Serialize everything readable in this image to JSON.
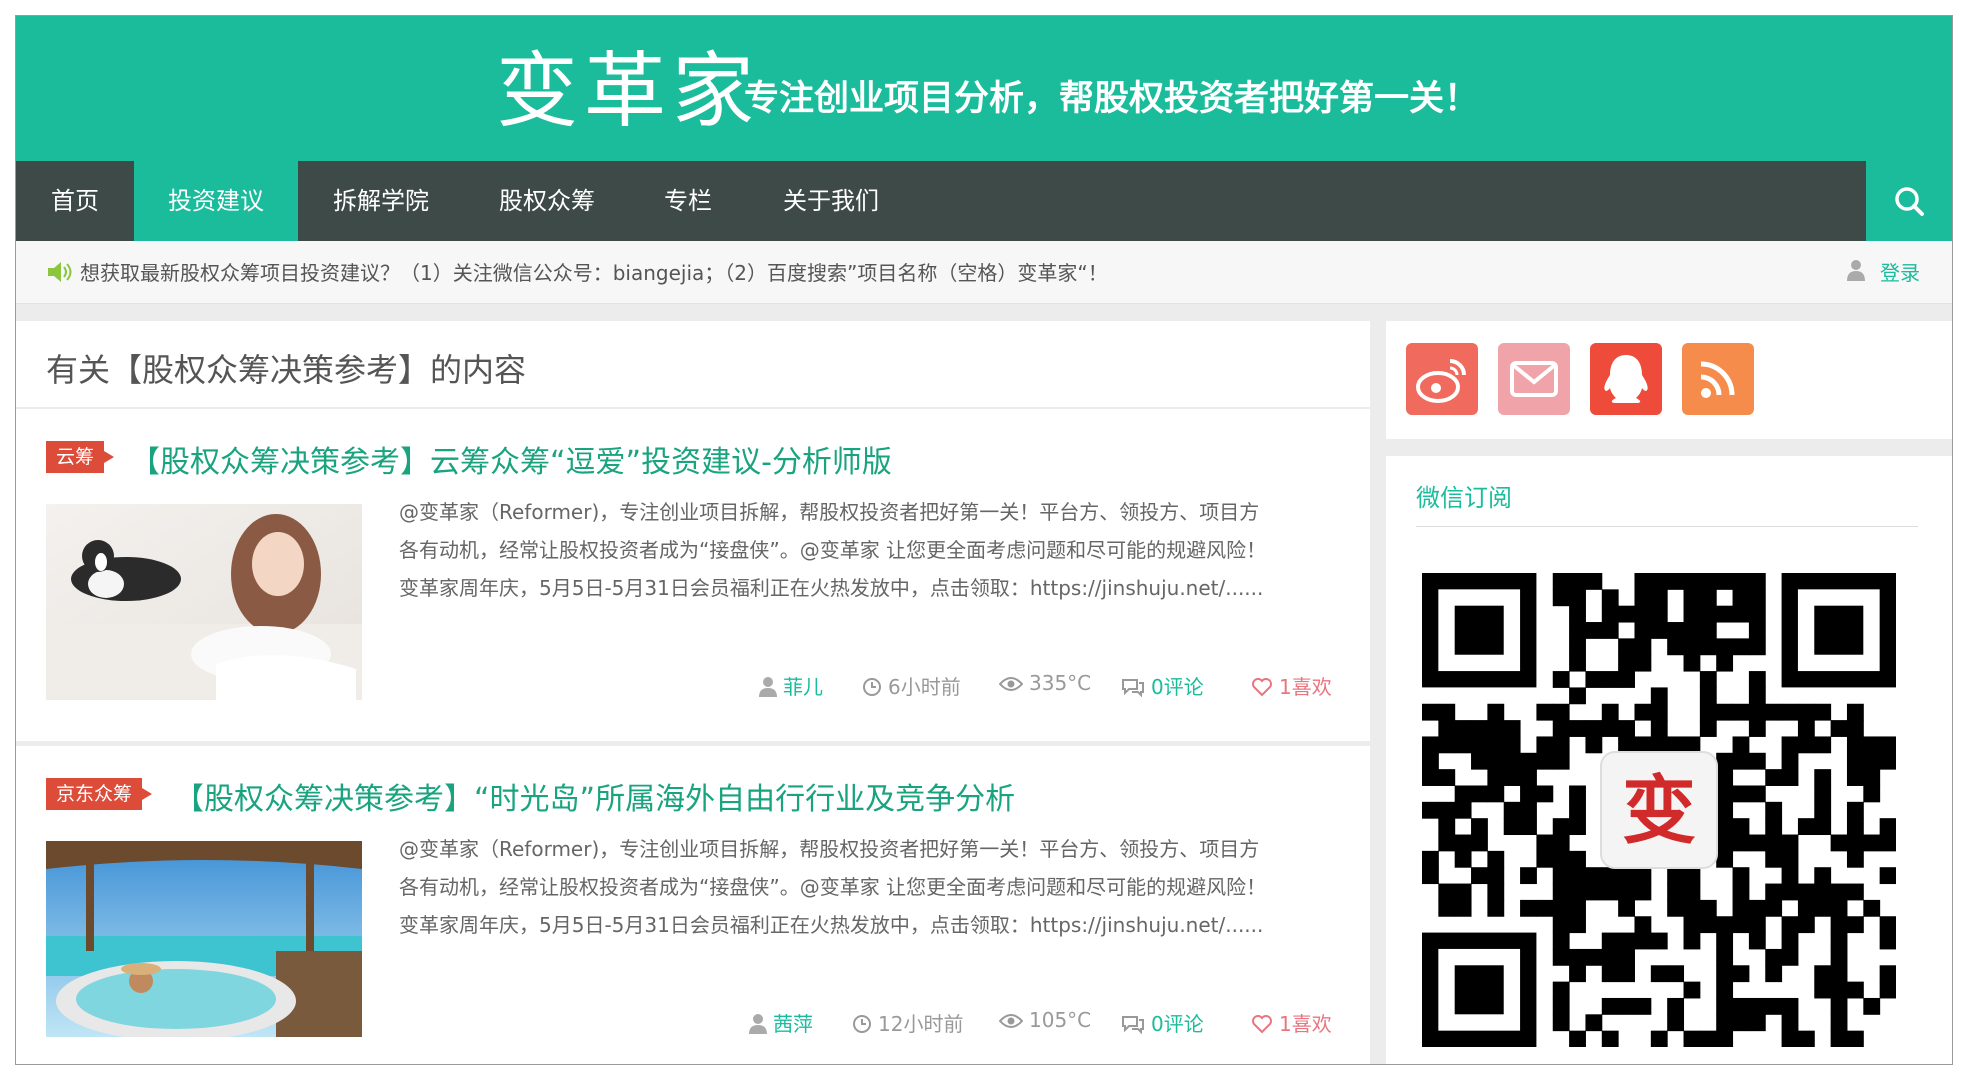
{
  "site": {
    "logo": "变革家",
    "slogan": "专注创业项目分析，帮股权投资者把好第一关！"
  },
  "nav": {
    "items": [
      "首页",
      "投资建议",
      "拆解学院",
      "股权众筹",
      "专栏",
      "关于我们"
    ],
    "active": "投资建议",
    "search_icon": "search-icon"
  },
  "notice": {
    "text": "想获取最新股权众筹项目投资建议？（1）关注微信公众号：biangejia；（2）百度搜索”项目名称（空格）变革家“！",
    "login": "登录"
  },
  "section": {
    "title": "有关【股权众筹决策参考】的内容"
  },
  "posts": [
    {
      "tag": "云筹",
      "title": "【股权众筹决策参考】云筹众筹“逗爱”投资建议-分析师版",
      "excerpt": [
        "@变革家（Reformer)，专注创业项目拆解，帮股权投资者把好第一关！平台方、领投方、项目方",
        "各有动机，经常让股权投资者成为“接盘侠”。@变革家 让您更全面考虑问题和尽可能的规避风险！",
        "变革家周年庆，5月5日-5月31日会员福利正在火热发放中，点击领取：https://jinshuju.net/......"
      ],
      "author": "菲儿",
      "time": "6小时前",
      "views": "335°C",
      "comments": "0评论",
      "likes": "1喜欢"
    },
    {
      "tag": "京东众筹",
      "title": "【股权众筹决策参考】“时光岛”所属海外自由行行业及竞争分析",
      "excerpt": [
        "@变革家（Reformer)，专注创业项目拆解，帮股权投资者把好第一关！平台方、领投方、项目方",
        "各有动机，经常让股权投资者成为“接盘侠”。@变革家 让您更全面考虑问题和尽可能的规避风险！",
        "变革家周年庆，5月5日-5月31日会员福利正在火热发放中，点击领取：https://jinshuju.net/......"
      ],
      "author": "茜萍",
      "time": "12小时前",
      "views": "105°C",
      "comments": "0评论",
      "likes": "1喜欢"
    }
  ],
  "sidebar": {
    "social": [
      {
        "name": "weibo-icon",
        "color": "#f06b5e"
      },
      {
        "name": "mail-icon",
        "color": "#f0a3a8"
      },
      {
        "name": "qq-icon",
        "color": "#ee4b3a"
      },
      {
        "name": "rss-icon",
        "color": "#f58c4b"
      }
    ],
    "wechat_title": "微信订阅",
    "qr_center": "变"
  },
  "colors": {
    "brand": "#1abc9c",
    "nav": "#3e4a47",
    "tag": "#dd4b39"
  }
}
